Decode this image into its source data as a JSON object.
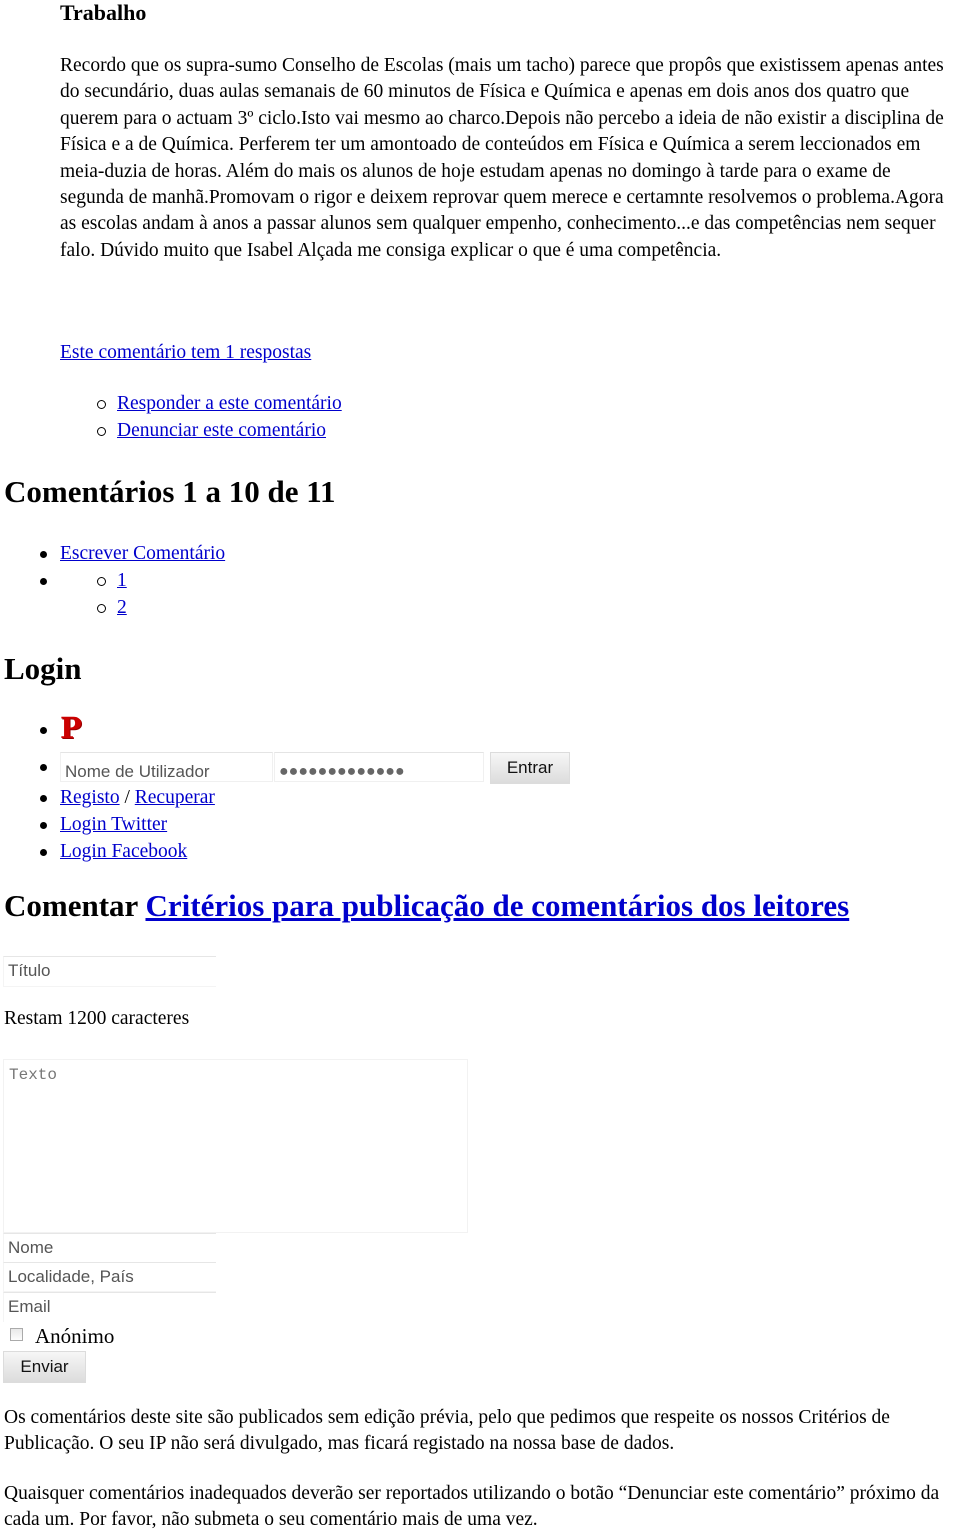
{
  "comment": {
    "title": "Trabalho",
    "body": "Recordo que os supra-sumo Conselho de Escolas (mais um tacho) parece que propôs que existissem apenas antes do secundário, duas aulas semanais de 60 minutos de Física e Química e apenas em dois anos dos quatro que querem para o actuam 3º ciclo.Isto vai mesmo ao charco.Depois não percebo a ideia de não existir a disciplina de Física e a de Química. Perferem ter um amontoado de conteúdos em Física e Química a serem leccionados em meia-duzia de horas. Além do mais os alunos de hoje estudam apenas no domingo à tarde para o exame de segunda de manhã.Promovam o rigor e deixem reprovar quem merece e certamnte resolvemos o problema.Agora as escolas andam à anos a passar alunos sem qualquer empenho, conhecimento...e das competências nem sequer falo. Dúvido muito que Isabel Alçada me consiga explicar o que é uma competência.",
    "replies_link": "Este comentário tem 1 respostas",
    "actions": [
      {
        "label": "Responder a este comentário"
      },
      {
        "label": "Denunciar este comentário"
      }
    ]
  },
  "comments_section": {
    "heading": "Comentários 1 a 10 de 11",
    "write_link": "Escrever Comentário",
    "pages": [
      "1",
      "2"
    ]
  },
  "login": {
    "heading": "Login",
    "logo_letter": "P",
    "username_placeholder": "Nome de Utilizador",
    "password_mask": "●●●●●●●●●●●●●",
    "submit_label": "Entrar",
    "register_link": "Registo",
    "separator": " / ",
    "recover_link": "Recuperar",
    "twitter_link": "Login Twitter",
    "facebook_link": "Login Facebook"
  },
  "comment_form": {
    "heading": "Comentar",
    "criteria_link": "Critérios para publicação de comentários dos leitores",
    "title_placeholder": "Título",
    "chars_remaining": "Restam 1200 caracteres",
    "text_placeholder": "Texto",
    "name_placeholder": "Nome",
    "location_placeholder": "Localidade, País",
    "email_placeholder": "Email",
    "anonymous_label": "Anónimo",
    "anonymous_checked": false,
    "submit_label": "Enviar"
  },
  "notes": {
    "policy": "Os comentários deste site são publicados sem edição prévia, pelo que pedimos que respeite os nossos Critérios de Publicação. O seu IP não será divulgado, mas ficará registado na nossa base de dados.",
    "report": "Quaisquer comentários inadequados deverão ser reportados utilizando o botão “Denunciar este comentário” próximo da cada um. Por favor, não submeta o seu comentário mais de uma vez."
  },
  "colors": {
    "link": "#0000cc",
    "logo": "#cc0000"
  }
}
